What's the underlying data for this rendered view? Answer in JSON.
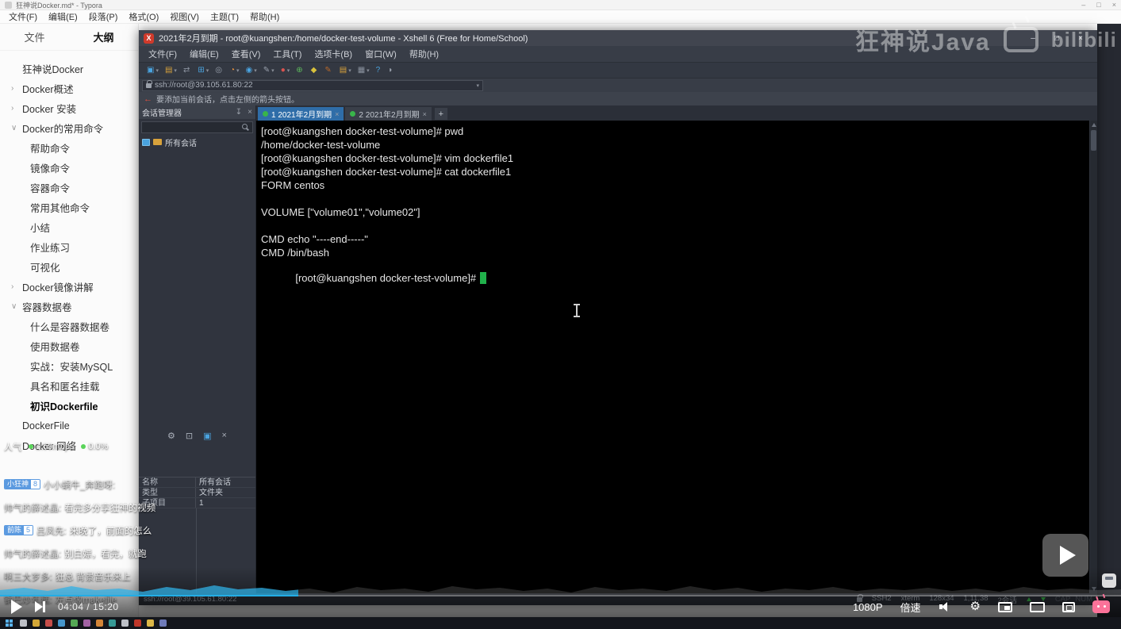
{
  "player": {
    "watermark_text": "狂神说Java",
    "watermark_logo_text": "bilibili",
    "current_time": "04:04",
    "time_separator": " / ",
    "duration": "15:20",
    "quality_label": "1080P",
    "speed_label": "倍速",
    "settings_glyph": "⚙",
    "progress_percent": "26.6",
    "accent_color": "#23ade5"
  },
  "stats_overlay": {
    "prefix": "人气",
    "items": [
      "1.59mbps",
      "0.0%"
    ]
  },
  "danmaku": [
    {
      "medal": "小狂神",
      "medal_level": "8",
      "user": "小小蜗牛_奔跑呀:",
      "text": ""
    },
    {
      "medal": "",
      "medal_level": "",
      "user": "帅气的薛述晶:",
      "text": "看完多分享狂神的视频"
    },
    {
      "medal": "前陈",
      "medal_level": "5",
      "user": "吕凤先:",
      "text": "来晚了，前面的怎么"
    },
    {
      "medal": "",
      "medal_level": "",
      "user": "帅气的薛述晶:",
      "text": "别白嫖，看完，就跑"
    },
    {
      "medal": "",
      "medal_level": "",
      "user": "啊三大岁多:",
      "text": "狂总 背景音乐来上"
    },
    {
      "medal": "",
      "medal_level": "",
      "user": "锅巴炒年糕:",
      "text": "左点像makefile"
    }
  ],
  "typora": {
    "window_title": "狂神说Docker.md* - Typora",
    "controls": {
      "minimize": "–",
      "maximize": "□",
      "close": "×"
    },
    "menus": [
      "文件(F)",
      "编辑(E)",
      "段落(P)",
      "格式(O)",
      "视图(V)",
      "主题(T)",
      "帮助(H)"
    ],
    "sidebar_tabs": [
      {
        "label": "文件",
        "active": "false"
      },
      {
        "label": "大纲",
        "active": "true"
      }
    ],
    "outline": [
      {
        "label": "狂神说Docker",
        "level": "0",
        "arrow": "",
        "bold": "false"
      },
      {
        "label": "Docker概述",
        "level": "0",
        "arrow": "›",
        "bold": "false"
      },
      {
        "label": "Docker 安装",
        "level": "0",
        "arrow": "›",
        "bold": "false"
      },
      {
        "label": "Docker的常用命令",
        "level": "0",
        "arrow": "∨",
        "bold": "false"
      },
      {
        "label": "帮助命令",
        "level": "1",
        "arrow": "",
        "bold": "false"
      },
      {
        "label": "镜像命令",
        "level": "1",
        "arrow": "",
        "bold": "false"
      },
      {
        "label": "容器命令",
        "level": "1",
        "arrow": "",
        "bold": "false"
      },
      {
        "label": "常用其他命令",
        "level": "1",
        "arrow": "",
        "bold": "false"
      },
      {
        "label": "小结",
        "level": "1",
        "arrow": "",
        "bold": "false"
      },
      {
        "label": "作业练习",
        "level": "1",
        "arrow": "",
        "bold": "false"
      },
      {
        "label": "可视化",
        "level": "1",
        "arrow": "",
        "bold": "false"
      },
      {
        "label": "Docker镜像讲解",
        "level": "0",
        "arrow": "›",
        "bold": "false"
      },
      {
        "label": "容器数据卷",
        "level": "0",
        "arrow": "∨",
        "bold": "false"
      },
      {
        "label": "什么是容器数据卷",
        "level": "1",
        "arrow": "",
        "bold": "false"
      },
      {
        "label": "使用数据卷",
        "level": "1",
        "arrow": "",
        "bold": "false"
      },
      {
        "label": "实战：安装MySQL",
        "level": "1",
        "arrow": "",
        "bold": "false"
      },
      {
        "label": "具名和匿名挂载",
        "level": "1",
        "arrow": "",
        "bold": "false"
      },
      {
        "label": "初识Dockerfile",
        "level": "1",
        "arrow": "",
        "bold": "true"
      },
      {
        "label": "DockerFile",
        "level": "0",
        "arrow": "",
        "bold": "false"
      },
      {
        "label": "Docker 网络",
        "level": "0",
        "arrow": "",
        "bold": "false"
      }
    ]
  },
  "xshell": {
    "window_title": "2021年2月到期 - root@kuangshen:/home/docker-test-volume - Xshell 6 (Free for Home/School)",
    "app_icon_letter": "X",
    "controls": {
      "minimize": "–",
      "maximize": "□",
      "close": "×"
    },
    "menus": [
      "文件(F)",
      "编辑(E)",
      "查看(V)",
      "工具(T)",
      "选项卡(B)",
      "窗口(W)",
      "帮助(H)"
    ],
    "toolbar_icons": [
      {
        "name": "new-session-icon",
        "glyph": "▣",
        "color": "#4aa3df",
        "caret": "▾"
      },
      {
        "name": "open-session-icon",
        "glyph": "▤",
        "color": "#d8a23c",
        "caret": "▾"
      },
      {
        "name": "reconnect-icon",
        "glyph": "⇄",
        "color": "#8a929e",
        "caret": ""
      },
      {
        "name": "duplicate-tab-icon",
        "glyph": "⊞",
        "color": "#4aa3df",
        "caret": "▾"
      },
      {
        "name": "find-icon",
        "glyph": "◎",
        "color": "#9aa2ae",
        "caret": ""
      },
      {
        "name": "dashboard-icon",
        "glyph": "◔",
        "color": "#e8913c",
        "caret": "▾"
      },
      {
        "name": "network-icon",
        "glyph": "◉",
        "color": "#4aa3df",
        "caret": "▾"
      },
      {
        "name": "compose-icon",
        "glyph": "✎",
        "color": "#9aa2ae",
        "caret": "▾"
      },
      {
        "name": "record-icon",
        "glyph": "●",
        "color": "#d9534f",
        "caret": "▾"
      },
      {
        "name": "fullscreen-arrows-icon",
        "glyph": "⊕",
        "color": "#5cb85c",
        "caret": ""
      },
      {
        "name": "lock-icon",
        "glyph": "◆",
        "color": "#d8c13c",
        "caret": ""
      },
      {
        "name": "marker-icon",
        "glyph": "✎",
        "color": "#b8682a",
        "caret": ""
      },
      {
        "name": "folder-icon",
        "glyph": "▤",
        "color": "#d8a23c",
        "caret": "▾"
      },
      {
        "name": "layout-icon",
        "glyph": "▦",
        "color": "#8a929e",
        "caret": "▾"
      },
      {
        "name": "help-icon",
        "glyph": "?",
        "color": "#4aa3df",
        "caret": ""
      },
      {
        "name": "feedback-icon",
        "glyph": "◗",
        "color": "#9aa2ae",
        "caret": ""
      }
    ],
    "address": "ssh://root@39.105.61.80:22",
    "address_caret": "▾",
    "notice_arrow": "←",
    "notice": "要添加当前会话，点击左侧的箭头按钮。",
    "session_manager": {
      "title": "会话管理器",
      "header_icons": [
        {
          "name": "pin-icon",
          "glyph": "↧"
        },
        {
          "name": "close-icon",
          "glyph": "×"
        }
      ],
      "tree_root": "所有会话",
      "tool_icons": [
        {
          "name": "settings-icon",
          "glyph": "⚙",
          "color": "#aab0ba"
        },
        {
          "name": "lock-icon",
          "glyph": "⊡",
          "color": "#aab0ba"
        },
        {
          "name": "layout-icon",
          "glyph": "▣",
          "color": "#4aa3df"
        },
        {
          "name": "close-icon",
          "glyph": "×",
          "color": "#aab0ba"
        }
      ],
      "properties": [
        {
          "k": "名称",
          "v": "所有会话"
        },
        {
          "k": "类型",
          "v": "文件夹"
        },
        {
          "k": "子项目",
          "v": "1"
        }
      ]
    },
    "tabs": [
      {
        "label": "1 2021年2月到期",
        "active": "true",
        "close": "×"
      },
      {
        "label": "2 2021年2月到期",
        "active": "false",
        "close": "×"
      }
    ],
    "tab_add": "+",
    "terminal": {
      "lines": [
        "[root@kuangshen docker-test-volume]# pwd",
        "/home/docker-test-volume",
        "[root@kuangshen docker-test-volume]# vim dockerfile1",
        "[root@kuangshen docker-test-volume]# cat dockerfile1",
        "FORM centos",
        "",
        "VOLUME [\"volume01\",\"volume02\"]",
        "",
        "CMD echo \"----end-----\"",
        "CMD /bin/bash"
      ],
      "prompt": "[root@kuangshen docker-test-volume]# "
    },
    "statusbar": {
      "left": "ssh://root@39.105.61.80:22",
      "items": [
        "SSH2",
        "xterm",
        "128x34",
        "1,11,38",
        "2会话"
      ],
      "dim_items": [
        "CAP",
        "NUM"
      ]
    }
  },
  "taskbar_icons": [
    {
      "name": "taskbar-search-icon",
      "color": "#cfd3da"
    },
    {
      "name": "taskbar-app-icon",
      "color": "#e8b73c"
    },
    {
      "name": "taskbar-app-icon",
      "color": "#d9534f"
    },
    {
      "name": "taskbar-app-icon",
      "color": "#4aa3df"
    },
    {
      "name": "taskbar-app-icon",
      "color": "#5cb85c"
    },
    {
      "name": "taskbar-app-icon",
      "color": "#b06ab3"
    },
    {
      "name": "taskbar-app-icon",
      "color": "#e8913c"
    },
    {
      "name": "taskbar-app-icon",
      "color": "#3aa7a3"
    },
    {
      "name": "taskbar-app-icon",
      "color": "#cfd3da"
    },
    {
      "name": "taskbar-app-icon",
      "color": "#d03a2b"
    },
    {
      "name": "taskbar-app-icon",
      "color": "#f2c94c"
    },
    {
      "name": "taskbar-app-icon",
      "color": "#7986cb"
    }
  ]
}
